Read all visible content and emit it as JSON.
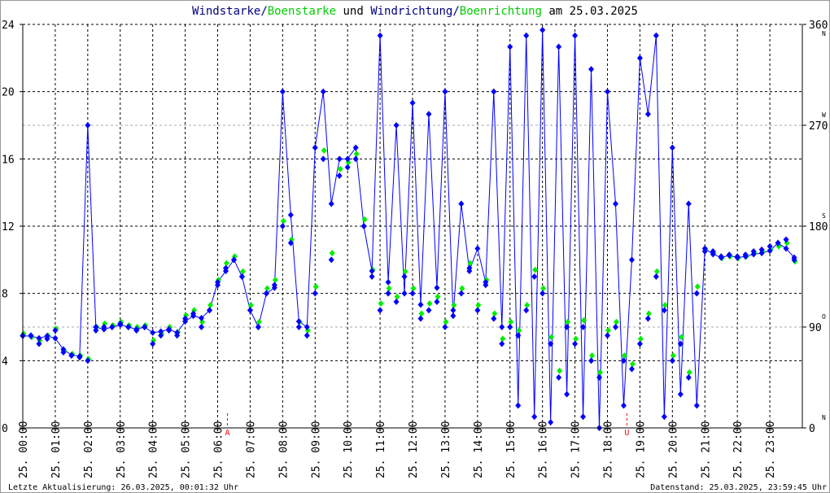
{
  "chart_data": {
    "type": "scatter",
    "title": {
      "part1": "Windstarke",
      "sep1": "/",
      "part2": "Boenstarke",
      "mid": " und ",
      "part3": "Windrichtung",
      "sep2": "/",
      "part4": "Boenrichtung",
      "tail": " am 25.03.2025"
    },
    "colors": {
      "wind": "#0000ff",
      "gust": "#00ee00",
      "title_wind": "#000080",
      "marker": "#ff0000"
    },
    "ylim_left": [
      0,
      24
    ],
    "ylim_right": [
      0,
      360
    ],
    "yticks_left": [
      "0",
      "4",
      "8",
      "12",
      "16",
      "20",
      "24"
    ],
    "yticks_right": [
      "0",
      "90",
      "180",
      "270",
      "360"
    ],
    "compass_labels": [
      "N",
      "O",
      "S",
      "W",
      "N"
    ],
    "xticks": [
      "25. 00:00",
      "25. 01:00",
      "25. 02:00",
      "25. 03:00",
      "25. 04:00",
      "25. 05:00",
      "25. 06:00",
      "25. 07:00",
      "25. 08:00",
      "25. 09:00",
      "25. 10:00",
      "25. 11:00",
      "25. 12:00",
      "25. 13:00",
      "25. 14:00",
      "25. 15:00",
      "25. 16:00",
      "25. 17:00",
      "25. 18:00",
      "25. 19:00",
      "25. 20:00",
      "25. 21:00",
      "25. 22:00",
      "25. 23:00"
    ],
    "event_markers": [
      {
        "label": "A",
        "hour": 6.3
      },
      {
        "label": "U",
        "hour": 18.6
      }
    ],
    "interval_minutes": 15,
    "series": [
      {
        "name": "Windstarke",
        "values": [
          5.5,
          5.5,
          5.0,
          5.3,
          5.8,
          4.5,
          4.3,
          4.2,
          4.0,
          5.8,
          6.0,
          6.0,
          6.2,
          6.0,
          5.8,
          6.0,
          5.0,
          5.5,
          5.8,
          5.5,
          6.5,
          6.8,
          6.0,
          7.0,
          8.5,
          9.5,
          10.0,
          9.0,
          7.0,
          6.0,
          8.0,
          8.5,
          12.0,
          11.0,
          6.0,
          5.5,
          8.0,
          16.0,
          10.0,
          15.0,
          15.5,
          16.0,
          12.0,
          9.0,
          7.0,
          8.0,
          7.5,
          9.0,
          8.0,
          6.5,
          7.0,
          7.5,
          6.0,
          7.0,
          8.0,
          9.5,
          7.0,
          8.5,
          6.5,
          5.0,
          6.0,
          5.5,
          7.0,
          9.0,
          8.0,
          5.0,
          3.0,
          6.0,
          5.0,
          6.0,
          4.0,
          3.0,
          5.5,
          6.0,
          4.0,
          3.5,
          5.0,
          6.5,
          9.0,
          7.0,
          4.0,
          5.0,
          3.0,
          8.0,
          10.5,
          10.5,
          10.2,
          10.3,
          10.2,
          10.3,
          10.5,
          10.6,
          10.8,
          11.0,
          11.2,
          10.0
        ]
      },
      {
        "name": "Boenstarke",
        "values": [
          5.6,
          5.4,
          5.2,
          5.5,
          5.9,
          4.6,
          4.4,
          4.3,
          4.1,
          6.0,
          6.2,
          6.1,
          6.3,
          6.1,
          6.0,
          6.1,
          5.2,
          5.6,
          6.0,
          5.7,
          6.7,
          7.0,
          6.3,
          7.3,
          8.8,
          9.8,
          10.2,
          9.3,
          7.3,
          6.3,
          8.3,
          8.8,
          12.3,
          11.2,
          6.3,
          5.8,
          8.4,
          16.5,
          10.4,
          15.4,
          15.8,
          16.3,
          12.4,
          9.4,
          7.4,
          8.3,
          7.8,
          9.3,
          8.3,
          6.8,
          7.4,
          7.8,
          6.3,
          7.3,
          8.3,
          9.8,
          7.3,
          8.8,
          6.8,
          5.3,
          6.3,
          5.8,
          7.3,
          9.4,
          8.3,
          5.4,
          3.4,
          6.3,
          5.3,
          6.4,
          4.3,
          3.3,
          5.8,
          6.3,
          4.3,
          3.8,
          5.3,
          6.8,
          9.3,
          7.3,
          4.3,
          5.4,
          3.3,
          8.4,
          10.6,
          10.4,
          10.1,
          10.2,
          10.1,
          10.2,
          10.4,
          10.5,
          10.6,
          10.8,
          11.0,
          9.9
        ]
      },
      {
        "name": "Windrichtung",
        "values": [
          82,
          82,
          80,
          82,
          80,
          70,
          65,
          64,
          270,
          90,
          88,
          90,
          92,
          90,
          88,
          90,
          85,
          86,
          88,
          85,
          95,
          100,
          98,
          105,
          130,
          140,
          150,
          135,
          105,
          90,
          120,
          125,
          300,
          190,
          95,
          90,
          250,
          300,
          200,
          240,
          240,
          250,
          180,
          140,
          350,
          130,
          270,
          120,
          290,
          110,
          280,
          125,
          300,
          100,
          200,
          140,
          160,
          130,
          300,
          90,
          340,
          20,
          350,
          10,
          355,
          5,
          340,
          30,
          350,
          10,
          320,
          0,
          300,
          200,
          20,
          150,
          330,
          280,
          350,
          10,
          250,
          30,
          200,
          20,
          160,
          155,
          152,
          154,
          152,
          153,
          155,
          156,
          158,
          165,
          160,
          152
        ]
      }
    ]
  },
  "footer": {
    "last_update": "Letzte Aktualisierung: 26.03.2025, 00:01:32 Uhr",
    "data_state": "Datenstand: 25.03.2025, 23:59:45 Uhr"
  }
}
